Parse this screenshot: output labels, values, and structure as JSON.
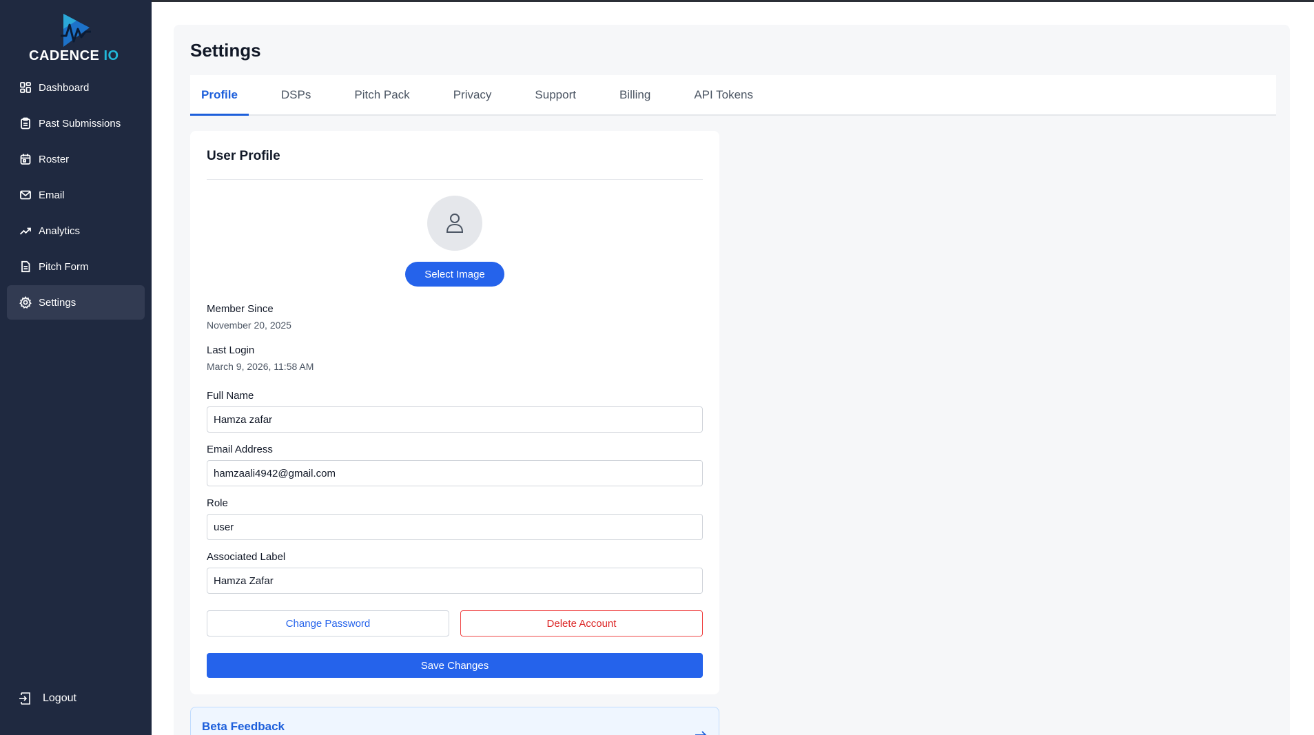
{
  "brand": {
    "name_main": "CADENCE",
    "name_suffix": " IO",
    "accent_color": "#22b8d9"
  },
  "sidebar": {
    "items": [
      {
        "label": "Dashboard",
        "icon": "dashboard-icon",
        "active": false
      },
      {
        "label": "Past Submissions",
        "icon": "clipboard-icon",
        "active": false
      },
      {
        "label": "Roster",
        "icon": "calendar-icon",
        "active": false
      },
      {
        "label": "Email",
        "icon": "mail-icon",
        "active": false
      },
      {
        "label": "Analytics",
        "icon": "trending-up-icon",
        "active": false
      },
      {
        "label": "Pitch Form",
        "icon": "document-icon",
        "active": false
      },
      {
        "label": "Settings",
        "icon": "gear-icon",
        "active": true
      }
    ],
    "logout_label": "Logout"
  },
  "page": {
    "title": "Settings"
  },
  "tabs": [
    {
      "label": "Profile",
      "active": true
    },
    {
      "label": "DSPs",
      "active": false
    },
    {
      "label": "Pitch Pack",
      "active": false
    },
    {
      "label": "Privacy",
      "active": false
    },
    {
      "label": "Support",
      "active": false
    },
    {
      "label": "Billing",
      "active": false
    },
    {
      "label": "API Tokens",
      "active": false
    }
  ],
  "profile": {
    "title": "User Profile",
    "select_image_label": "Select Image",
    "member_since_label": "Member Since",
    "member_since_value": "November 20, 2025",
    "last_login_label": "Last Login",
    "last_login_value": "March 9, 2026, 11:58 AM",
    "fields": {
      "full_name": {
        "label": "Full Name",
        "value": "Hamza zafar"
      },
      "email": {
        "label": "Email Address",
        "value": "hamzaali4942@gmail.com"
      },
      "role": {
        "label": "Role",
        "value": "user"
      },
      "label": {
        "label": "Associated Label",
        "value": "Hamza Zafar"
      }
    },
    "change_password_label": "Change Password",
    "delete_account_label": "Delete Account",
    "save_label": "Save Changes"
  },
  "feedback": {
    "title": "Beta Feedback"
  },
  "colors": {
    "sidebar_bg": "#1f2940",
    "primary": "#2563eb",
    "danger": "#dc2626"
  }
}
